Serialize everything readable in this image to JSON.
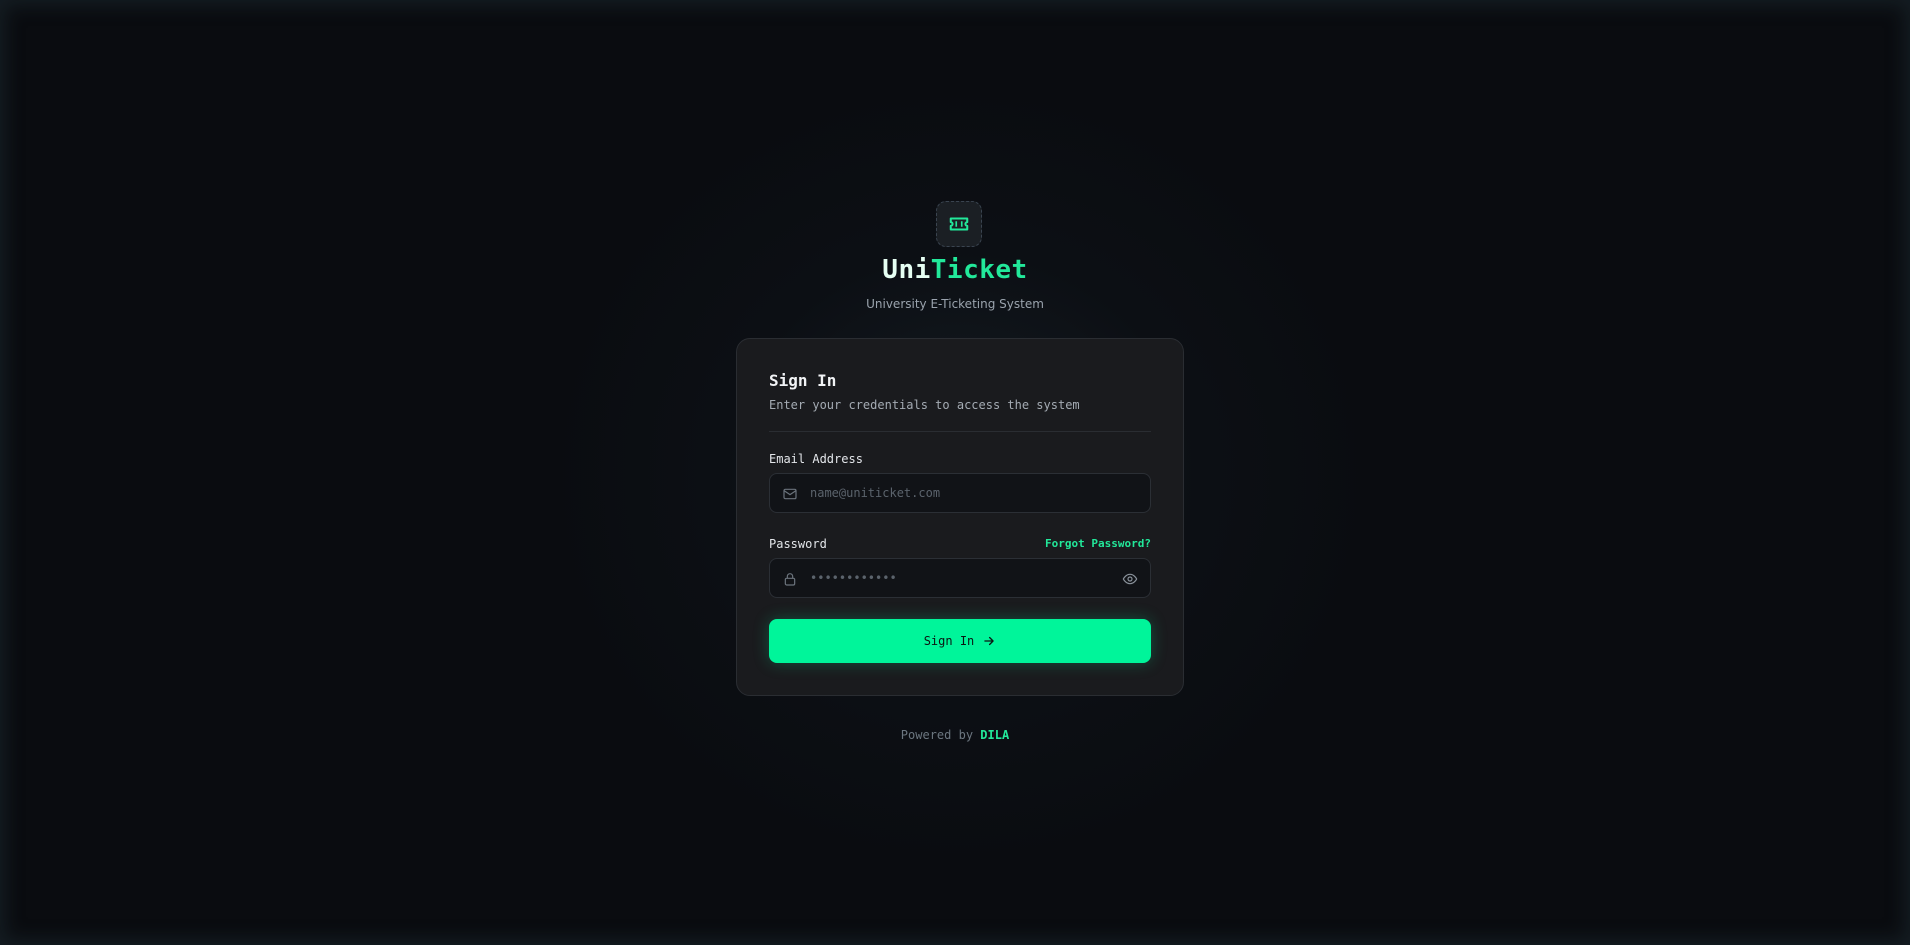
{
  "app": {
    "title_part1": "Uni",
    "title_part2": "Ticket",
    "subtitle": "University E-Ticketing System",
    "logo_icon": "ticket-icon"
  },
  "signin": {
    "title": "Sign In",
    "subtitle": "Enter your credentials to access the system",
    "email_label": "Email Address",
    "email_placeholder": "name@uniticket.com",
    "email_value": "",
    "password_label": "Password",
    "password_placeholder": "••••••••••••",
    "password_value": "",
    "forgot_label": "Forgot Password?",
    "submit_label": "Sign In",
    "icons": {
      "email": "mail-icon",
      "password": "lock-icon",
      "reveal": "eye-icon",
      "submit": "arrow-right-icon"
    }
  },
  "footer": {
    "prefix": "Powered by",
    "brand": "DILA"
  },
  "colors": {
    "accent": "#00f59a",
    "accent_text": "#22e89a",
    "background": "#0a0c10",
    "card": "#1a1b1e"
  }
}
